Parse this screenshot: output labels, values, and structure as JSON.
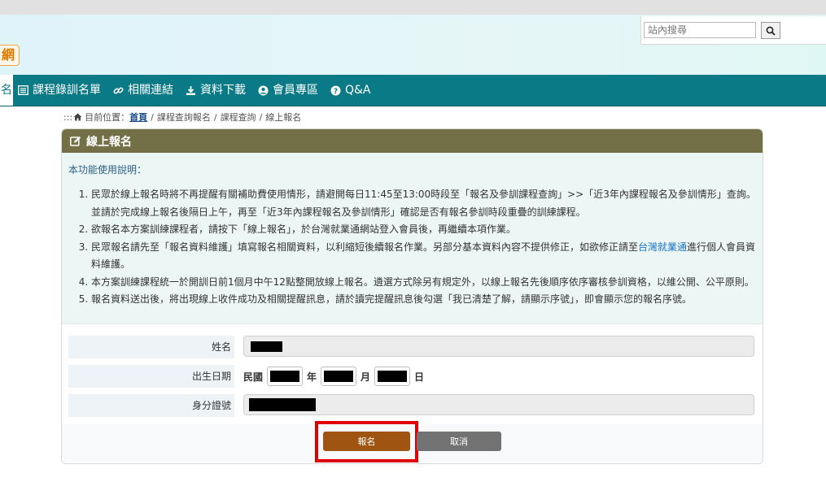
{
  "header": {
    "logo_text": "網",
    "search_placeholder": "站內搜尋"
  },
  "nav": {
    "active_fragment": "名",
    "items": [
      {
        "label": "課程錄訓名單",
        "icon": "list-icon"
      },
      {
        "label": "相關連結",
        "icon": "link-icon"
      },
      {
        "label": "資料下載",
        "icon": "download-icon"
      },
      {
        "label": "會員專區",
        "icon": "user-circle-icon"
      },
      {
        "label": "Q&A",
        "icon": "question-circle-icon"
      }
    ]
  },
  "breadcrumb": {
    "prefix": ":::",
    "label": "目前位置：",
    "home": "首頁",
    "items": [
      "課程查詢報名",
      "課程查詢",
      "線上報名"
    ]
  },
  "panel": {
    "title": "線上報名",
    "info_title": "本功能使用說明：",
    "instructions": [
      "民眾於線上報名時將不再提醒有關補助費使用情形，請避開每日11:45至13:00時段至「報名及參訓課程查詢」>>「近3年內課程報名及參訓情形」查詢。並請於完成線上報名後隔日上午，再至「近3年內課程報名及參訓情形」確認是否有報名參訓時段重疊的訓練課程。",
      "欲報名本方案訓練課程者，請按下「線上報名」，於台灣就業通網站登入會員後，再繼續本項作業。",
      "民眾報名請先至「報名資料維護」填寫報名相關資料，以利縮短後續報名作業。另部分基本資料內容不提供修正，如欲修正請至",
      "本方案訓練課程統一於開訓日前1個月中午12點整開放線上報名。遴選方式除另有規定外，以線上報名先後順序依序審核參訓資格，以維公開、公平原則。",
      "報名資料送出後，將出現線上收件成功及相關提醒訊息，請於讀完提醒訊息後勾選「我已清楚了解，請顯示序號」，即會顯示您的報名序號。"
    ],
    "instruction3_link": "台灣就業通",
    "instruction3_suffix": "進行個人會員資料維護。"
  },
  "form": {
    "name_label": "姓名",
    "birth_label": "出生日期",
    "birth_era": "民國",
    "year_unit": "年",
    "month_unit": "月",
    "day_unit": "日",
    "id_label": "身分證號"
  },
  "buttons": {
    "submit": "報名",
    "cancel": "取消"
  },
  "colors": {
    "nav_bg": "#0a7a86",
    "panel_head": "#737047",
    "submit_bg": "#a05411",
    "cancel_bg": "#727272",
    "highlight": "#e00000"
  }
}
